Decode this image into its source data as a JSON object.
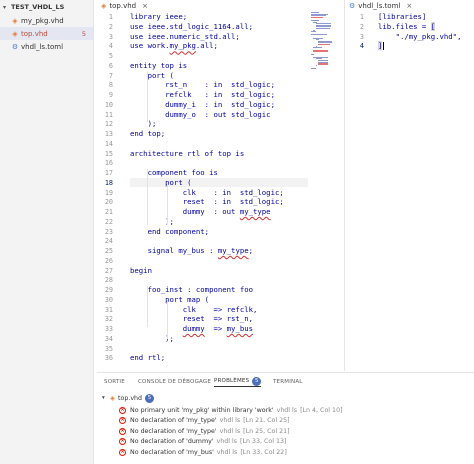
{
  "explorer": {
    "root_label": "TEST_VHDL_LS",
    "files": [
      {
        "name": "my_pkg.vhd",
        "icon": "vhdl-file-icon",
        "error_count": ""
      },
      {
        "name": "top.vhd",
        "icon": "vhdl-file-icon",
        "error_count": "5"
      },
      {
        "name": "vhdl_ls.toml",
        "icon": "gear-icon",
        "error_count": ""
      }
    ]
  },
  "editor1": {
    "tab_label": "top.vhd",
    "lines": [
      {
        "n": "1",
        "segs": [
          {
            "t": "library ieee;"
          }
        ]
      },
      {
        "n": "2",
        "segs": [
          {
            "t": "use ieee.std_logic_1164.all;"
          }
        ]
      },
      {
        "n": "3",
        "segs": [
          {
            "t": "use ieee.numeric_std.all;"
          }
        ]
      },
      {
        "n": "4",
        "segs": [
          {
            "t": "use work."
          },
          {
            "t": "my_pkg",
            "sq": true
          },
          {
            "t": ".all;"
          }
        ]
      },
      {
        "n": "5",
        "segs": [
          {
            "t": ""
          }
        ]
      },
      {
        "n": "6",
        "segs": [
          {
            "t": "entity top is"
          }
        ]
      },
      {
        "n": "7",
        "segs": [
          {
            "t": "    port ("
          }
        ]
      },
      {
        "n": "8",
        "segs": [
          {
            "t": "        rst_n    : in  std_logic;"
          }
        ]
      },
      {
        "n": "9",
        "segs": [
          {
            "t": "        refclk   : in  std_logic;"
          }
        ]
      },
      {
        "n": "10",
        "segs": [
          {
            "t": "        dummy_i  : in  std_logic;"
          }
        ]
      },
      {
        "n": "11",
        "segs": [
          {
            "t": "        dummy_o  : out std_logic"
          }
        ]
      },
      {
        "n": "12",
        "segs": [
          {
            "t": "    );"
          }
        ]
      },
      {
        "n": "13",
        "segs": [
          {
            "t": "end top;"
          }
        ]
      },
      {
        "n": "14",
        "segs": [
          {
            "t": ""
          }
        ]
      },
      {
        "n": "15",
        "segs": [
          {
            "t": "architecture rtl of top is"
          }
        ]
      },
      {
        "n": "16",
        "segs": [
          {
            "t": ""
          }
        ]
      },
      {
        "n": "17",
        "segs": [
          {
            "t": "    component foo is"
          }
        ]
      },
      {
        "n": "18",
        "segs": [
          {
            "t": "        port ("
          }
        ],
        "current": true
      },
      {
        "n": "19",
        "segs": [
          {
            "t": "            clk    : in  std_logic;"
          }
        ]
      },
      {
        "n": "20",
        "segs": [
          {
            "t": "            reset  : in  std_logic;"
          }
        ]
      },
      {
        "n": "21",
        "segs": [
          {
            "t": "            dummy  : out "
          },
          {
            "t": "my_type",
            "sq": true
          }
        ]
      },
      {
        "n": "22",
        "segs": [
          {
            "t": "        );"
          }
        ]
      },
      {
        "n": "23",
        "segs": [
          {
            "t": "    end component;"
          }
        ]
      },
      {
        "n": "24",
        "segs": [
          {
            "t": ""
          }
        ]
      },
      {
        "n": "25",
        "segs": [
          {
            "t": "    signal my_bus : "
          },
          {
            "t": "my_type",
            "sq": true
          },
          {
            "t": ";"
          }
        ]
      },
      {
        "n": "26",
        "segs": [
          {
            "t": ""
          }
        ]
      },
      {
        "n": "27",
        "segs": [
          {
            "t": "begin"
          }
        ]
      },
      {
        "n": "28",
        "segs": [
          {
            "t": ""
          }
        ]
      },
      {
        "n": "29",
        "segs": [
          {
            "t": "    foo_inst : component foo"
          }
        ]
      },
      {
        "n": "30",
        "segs": [
          {
            "t": "        port map ("
          }
        ]
      },
      {
        "n": "31",
        "segs": [
          {
            "t": "            clk    => refclk,"
          }
        ]
      },
      {
        "n": "32",
        "segs": [
          {
            "t": "            reset  => rst_n,"
          }
        ]
      },
      {
        "n": "33",
        "segs": [
          {
            "t": "            "
          },
          {
            "t": "dummy",
            "sq": true
          },
          {
            "t": "  => "
          },
          {
            "t": "my_bus",
            "sq": true
          }
        ]
      },
      {
        "n": "34",
        "segs": [
          {
            "t": "        );"
          }
        ]
      },
      {
        "n": "35",
        "segs": [
          {
            "t": ""
          }
        ]
      },
      {
        "n": "36",
        "segs": [
          {
            "t": "end rtl;"
          }
        ]
      }
    ]
  },
  "editor2": {
    "tab_label": "vhdl_ls.toml",
    "lines": [
      {
        "n": "1",
        "segs": [
          {
            "t": "[libraries]"
          }
        ]
      },
      {
        "n": "2",
        "segs": [
          {
            "t": "lib.files = "
          },
          {
            "t": "[",
            "hl": true
          }
        ]
      },
      {
        "n": "3",
        "segs": [
          {
            "t": "    \"./my_pkg.vhd\","
          }
        ]
      },
      {
        "n": "4",
        "segs": [
          {
            "t": "]",
            "hl": true
          }
        ],
        "current": true
      }
    ]
  },
  "panel": {
    "tabs": [
      {
        "label": "SORTIE",
        "active": false
      },
      {
        "label": "CONSOLE DE DÉBOGAGE",
        "active": false
      },
      {
        "label": "PROBLÈMES",
        "active": true,
        "badge": "5"
      },
      {
        "label": "TERMINAL",
        "active": false
      }
    ],
    "problem_file": {
      "name": "top.vhd",
      "count": "5"
    },
    "problems": [
      {
        "message": "No primary unit 'my_pkg' within library 'work'",
        "source": "vhdl ls",
        "location": "[Ln 4, Col 10]"
      },
      {
        "message": "No declaration of 'my_type'",
        "source": "vhdl ls",
        "location": "[Ln 21, Col 25]"
      },
      {
        "message": "No declaration of 'my_type'",
        "source": "vhdl ls",
        "location": "[Ln 25, Col 21]"
      },
      {
        "message": "No declaration of 'dummy'",
        "source": "vhdl ls",
        "location": "[Ln 33, Col 13]"
      },
      {
        "message": "No declaration of 'my_bus'",
        "source": "vhdl ls",
        "location": "[Ln 33, Col 22]"
      }
    ]
  },
  "colors": {
    "keyword_blue": "#0000a0",
    "error_red": "#e51400",
    "badge_blue": "#4a6eba"
  }
}
